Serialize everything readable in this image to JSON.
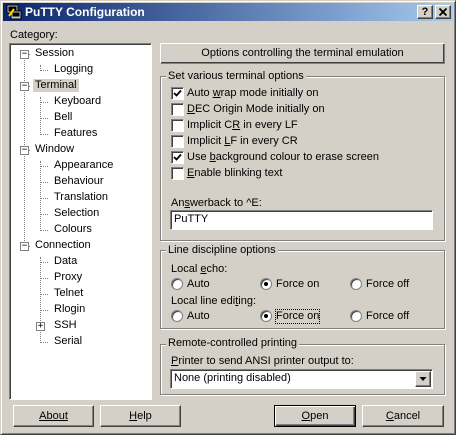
{
  "window": {
    "title": "PuTTY Configuration",
    "help_button": "?",
    "close_button": "X"
  },
  "category_label": "Category:",
  "tree": [
    {
      "label": "Session",
      "level": 0,
      "expander": "minus"
    },
    {
      "label": "Logging",
      "level": 1
    },
    {
      "label": "Terminal",
      "level": 0,
      "expander": "minus",
      "selected": true
    },
    {
      "label": "Keyboard",
      "level": 1
    },
    {
      "label": "Bell",
      "level": 1
    },
    {
      "label": "Features",
      "level": 1
    },
    {
      "label": "Window",
      "level": 0,
      "expander": "minus"
    },
    {
      "label": "Appearance",
      "level": 1
    },
    {
      "label": "Behaviour",
      "level": 1
    },
    {
      "label": "Translation",
      "level": 1
    },
    {
      "label": "Selection",
      "level": 1
    },
    {
      "label": "Colours",
      "level": 1
    },
    {
      "label": "Connection",
      "level": 0,
      "expander": "minus"
    },
    {
      "label": "Data",
      "level": 1
    },
    {
      "label": "Proxy",
      "level": 1
    },
    {
      "label": "Telnet",
      "level": 1
    },
    {
      "label": "Rlogin",
      "level": 1
    },
    {
      "label": "SSH",
      "level": 1,
      "expander": "plus"
    },
    {
      "label": "Serial",
      "level": 1
    }
  ],
  "panel_header": "Options controlling the terminal emulation",
  "terminal_options": {
    "title": "Set various terminal options",
    "checks": [
      {
        "pre": "Auto ",
        "ul": "w",
        "post": "rap mode initially on",
        "checked": true
      },
      {
        "pre": "",
        "ul": "D",
        "post": "EC Origin Mode initially on",
        "checked": false
      },
      {
        "pre": "Implicit C",
        "ul": "R",
        "post": " in every LF",
        "checked": false
      },
      {
        "pre": "Implicit ",
        "ul": "L",
        "post": "F in every CR",
        "checked": false
      },
      {
        "pre": "Use ",
        "ul": "b",
        "post": "ackground colour to erase screen",
        "checked": true
      },
      {
        "pre": "",
        "ul": "E",
        "post": "nable blinking text",
        "checked": false
      }
    ],
    "answerback_label_pre": "An",
    "answerback_label_ul": "s",
    "answerback_label_post": "werback to ^E:",
    "answerback_value": "PuTTY"
  },
  "line_discipline": {
    "title": "Line discipline options",
    "local_echo_label_pre": "Local ",
    "local_echo_label_ul": "e",
    "local_echo_label_post": "cho:",
    "local_editing_label_pre": "Local line edi",
    "local_editing_label_ul": "t",
    "local_editing_label_post": "ing:",
    "options": [
      "Auto",
      "Force on",
      "Force off"
    ],
    "echo_selected": "Force on",
    "editing_selected": "Force on"
  },
  "printing": {
    "title": "Remote-controlled printing",
    "label_pre": "",
    "label_ul": "P",
    "label_post": "rinter to send ANSI printer output to:",
    "value": "None (printing disabled)"
  },
  "buttons": {
    "about": "About",
    "help": "Help",
    "open": "Open",
    "cancel": "Cancel"
  }
}
